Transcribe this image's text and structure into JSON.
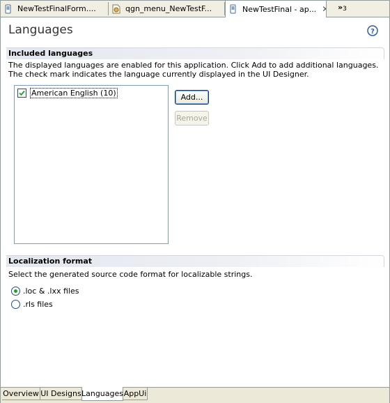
{
  "editor_tabs": [
    {
      "label": "NewTestFinalForm....",
      "icon": "file-icon",
      "active": false
    },
    {
      "label": "qgn_menu_NewTestF...",
      "icon": "image-file-icon",
      "active": false
    },
    {
      "label": "NewTestFinal - ap...",
      "icon": "file-icon",
      "active": true
    }
  ],
  "tab_overflow": {
    "chevron": "»",
    "count": "3"
  },
  "page": {
    "title": "Languages",
    "help_icon": "help-icon"
  },
  "included_languages": {
    "header": "Included languages",
    "desc_line1": "The displayed languages are enabled for this application. Click Add to add additional languages.",
    "desc_line2": "The check mark indicates the language currently displayed in the UI Designer.",
    "languages": [
      {
        "label": "American English (10)",
        "checked": true
      }
    ],
    "add_label": "Add...",
    "remove_label": "Remove"
  },
  "localization_format": {
    "header": "Localization format",
    "desc": "Select the generated source code format for localizable strings.",
    "options": [
      {
        "label": ".loc & .lxx files",
        "selected": true
      },
      {
        "label": ".rls files",
        "selected": false
      }
    ]
  },
  "bottom_tabs": [
    {
      "label": "Overview",
      "active": false
    },
    {
      "label": "UI Designs",
      "active": false
    },
    {
      "label": "Languages",
      "active": true
    },
    {
      "label": "AppUi",
      "active": false
    }
  ],
  "colors": {
    "accent_blue": "#1c5180",
    "radio_green": "#21a121",
    "header_gradient": "#e3e7ef",
    "frame_border": "#919b9c"
  }
}
